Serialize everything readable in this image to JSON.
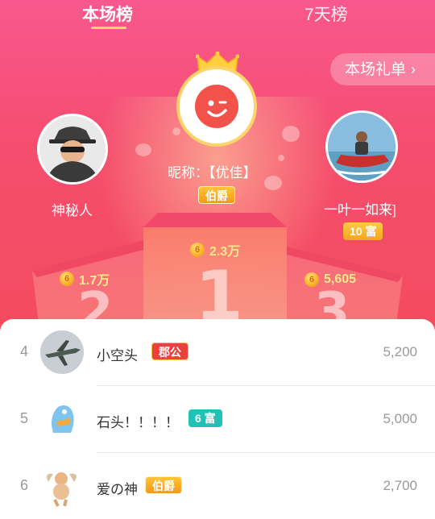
{
  "tabs": {
    "current": "本场榜",
    "weekly": "7天榜"
  },
  "gift_list_button": "本场礼单",
  "top3": {
    "first": {
      "name": "昵称：【优佳】",
      "badge": "伯爵",
      "score": "2.3万",
      "rank_digit": "1"
    },
    "second": {
      "name": "神秘人",
      "score": "1.7万",
      "rank_digit": "2"
    },
    "third": {
      "name": "一叶一如来]",
      "badge": "10 富",
      "score": "5,605",
      "rank_digit": "3"
    }
  },
  "list": [
    {
      "rank": "4",
      "name": "小空头",
      "badge": "郡公",
      "score": "5,200"
    },
    {
      "rank": "5",
      "name": "石头！！！！",
      "badge": "6 富",
      "score": "5,000"
    },
    {
      "rank": "6",
      "name": "爱の神",
      "badge": "伯爵",
      "score": "2,700"
    }
  ],
  "colors": {
    "hero_top": "#f9588e",
    "hero_bottom": "#f44b5e",
    "gold": "#ffd36b",
    "teal_badge": "#1fc3b5",
    "red_badge": "#e8423a"
  }
}
